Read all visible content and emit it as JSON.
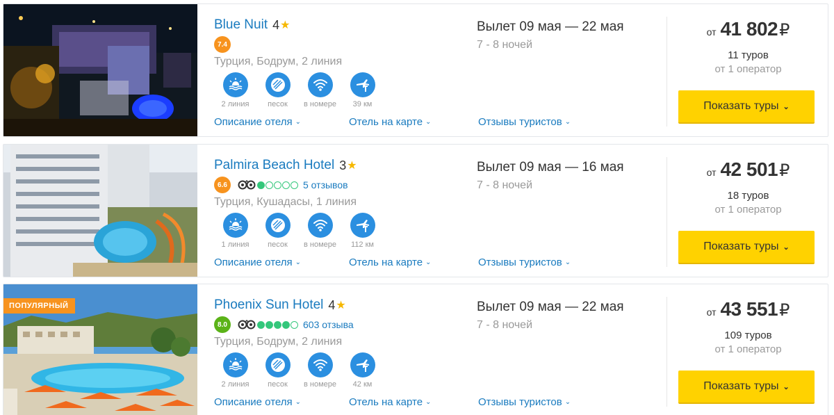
{
  "hotels": [
    {
      "name": "Blue Nuit",
      "stars": "4",
      "score": "7.4",
      "score_color": "#f7931e",
      "tripadvisor": null,
      "location": "Турция, Бодрум, 2 линия",
      "amenities": [
        {
          "icon": "beach-line-icon",
          "label": "2 линия"
        },
        {
          "icon": "sand-icon",
          "label": "песок"
        },
        {
          "icon": "wifi-icon",
          "label": "в номере"
        },
        {
          "icon": "airport-icon",
          "label": "39 км"
        }
      ],
      "links": {
        "description": "Описание отеля",
        "map": "Отель на карте",
        "reviews": "Отзывы туристов"
      },
      "departure": "Вылет 09 мая — 22 мая",
      "nights": "7 - 8 ночей",
      "price_from": "от",
      "price": "41 802",
      "currency": "₽",
      "tours": "11 туров",
      "operators": "от 1 оператор",
      "button": "Показать туры",
      "badge": null
    },
    {
      "name": "Palmira Beach Hotel",
      "stars": "3",
      "score": "6.6",
      "score_color": "#f7931e",
      "tripadvisor": {
        "rating": 1,
        "reviews": "5 отзывов"
      },
      "location": "Турция, Кушадасы, 1 линия",
      "amenities": [
        {
          "icon": "beach-line-icon",
          "label": "1 линия"
        },
        {
          "icon": "sand-icon",
          "label": "песок"
        },
        {
          "icon": "wifi-icon",
          "label": "в номере"
        },
        {
          "icon": "airport-icon",
          "label": "112 км"
        }
      ],
      "links": {
        "description": "Описание отеля",
        "map": "Отель на карте",
        "reviews": "Отзывы туристов"
      },
      "departure": "Вылет 09 мая — 16 мая",
      "nights": "7 - 8 ночей",
      "price_from": "от",
      "price": "42 501",
      "currency": "₽",
      "tours": "18 туров",
      "operators": "от 1 оператор",
      "button": "Показать туры",
      "badge": null
    },
    {
      "name": "Phoenix Sun Hotel",
      "stars": "4",
      "score": "8.0",
      "score_color": "#5bb318",
      "tripadvisor": {
        "rating": 4,
        "reviews": "603 отзыва"
      },
      "location": "Турция, Бодрум, 2 линия",
      "amenities": [
        {
          "icon": "beach-line-icon",
          "label": "2 линия"
        },
        {
          "icon": "sand-icon",
          "label": "песок"
        },
        {
          "icon": "wifi-icon",
          "label": "в номере"
        },
        {
          "icon": "airport-icon",
          "label": "42 км"
        }
      ],
      "links": {
        "description": "Описание отеля",
        "map": "Отель на карте",
        "reviews": "Отзывы туристов"
      },
      "departure": "Вылет 09 мая — 22 мая",
      "nights": "7 - 8 ночей",
      "price_from": "от",
      "price": "43 551",
      "currency": "₽",
      "tours": "109 туров",
      "operators": "от 1 оператор",
      "button": "Показать туры",
      "badge": "ПОПУЛЯРНЫЙ"
    }
  ],
  "colors": {
    "link": "#1a7bbf",
    "amenity": "#2b8fe0",
    "button": "#ffd200",
    "star": "#f6b800",
    "tripadvisor": "#34c77b",
    "badge": "#f7931e"
  }
}
